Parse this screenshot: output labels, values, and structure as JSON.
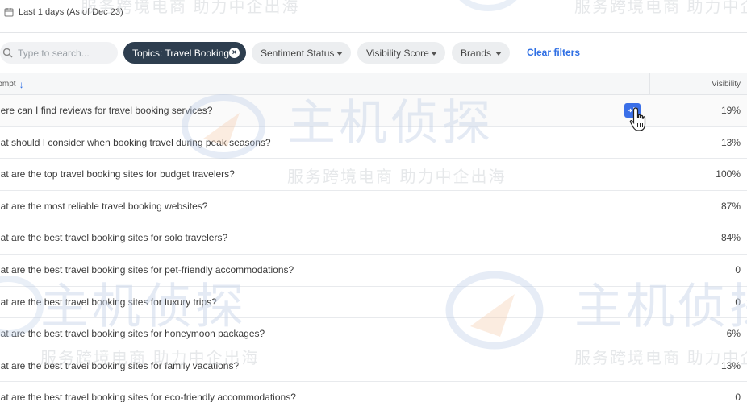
{
  "header": {
    "date_range": "Last 1 days (As of Dec 23)"
  },
  "filters": {
    "search_placeholder": "Type to search...",
    "active_chip": "Topics: Travel Booking",
    "dropdowns": [
      "Sentiment Status",
      "Visibility Score",
      "Brands"
    ],
    "clear_label": "Clear filters"
  },
  "table": {
    "col_prompt": "rompt",
    "col_visibility": "Visibility",
    "rows": [
      {
        "prompt": "here can I find reviews for travel booking services?",
        "visibility": "19%"
      },
      {
        "prompt": "hat should I consider when booking travel during peak seasons?",
        "visibility": "13%"
      },
      {
        "prompt": "hat are the top travel booking sites for budget travelers?",
        "visibility": "100%"
      },
      {
        "prompt": "hat are the most reliable travel booking websites?",
        "visibility": "87%"
      },
      {
        "prompt": "hat are the best travel booking sites for solo travelers?",
        "visibility": "84%"
      },
      {
        "prompt": "hat are the best travel booking sites for pet-friendly accommodations?",
        "visibility": "0"
      },
      {
        "prompt": "hat are the best travel booking sites for luxury trips?",
        "visibility": "0"
      },
      {
        "prompt": "hat are the best travel booking sites for honeymoon packages?",
        "visibility": "6%"
      },
      {
        "prompt": "hat are the best travel booking sites for family vacations?",
        "visibility": "13%"
      },
      {
        "prompt": "hat are the best travel booking sites for eco-friendly accommodations?",
        "visibility": "0"
      }
    ]
  },
  "watermark": {
    "brand": "主机侦探",
    "tagline": "服务跨境电商  助力中企出海"
  },
  "colors": {
    "accent": "#2f6fe4",
    "chip_active_bg": "#2e3e4f",
    "action_button": "#3a6fe8"
  }
}
